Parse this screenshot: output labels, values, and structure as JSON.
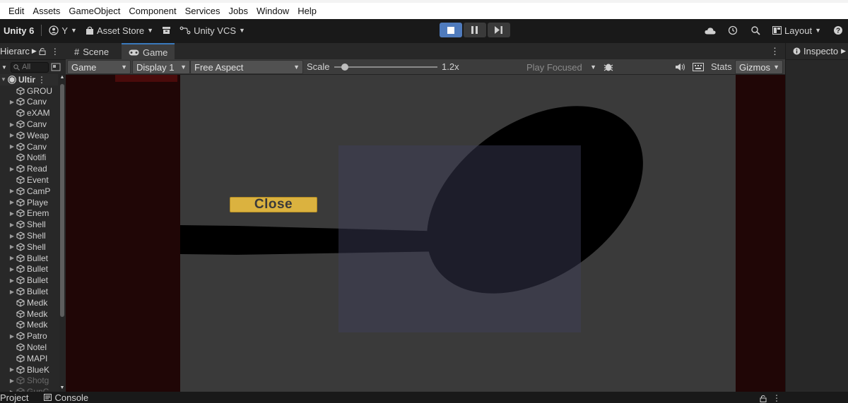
{
  "menu": [
    "Edit",
    "Assets",
    "GameObject",
    "Component",
    "Services",
    "Jobs",
    "Window",
    "Help"
  ],
  "toolbar": {
    "unity_label": "Unity 6",
    "account_label": "Y",
    "asset_store_label": "Asset Store",
    "vcs_label": "Unity VCS",
    "layout_label": "Layout"
  },
  "hierarchy": {
    "tab_label": "Hierarc",
    "search_placeholder": "All",
    "root_label": "Ultir",
    "items": [
      {
        "label": "GROU",
        "arrow": false,
        "dim": false
      },
      {
        "label": "Canv",
        "arrow": true,
        "dim": false
      },
      {
        "label": "eXAM",
        "arrow": false,
        "dim": false
      },
      {
        "label": "Canv",
        "arrow": true,
        "dim": false
      },
      {
        "label": "Weap",
        "arrow": true,
        "dim": false
      },
      {
        "label": "Canv",
        "arrow": true,
        "dim": false
      },
      {
        "label": "Notifi",
        "arrow": false,
        "dim": false
      },
      {
        "label": "Read",
        "arrow": true,
        "dim": false
      },
      {
        "label": "Event",
        "arrow": false,
        "dim": false
      },
      {
        "label": "CamP",
        "arrow": true,
        "dim": false
      },
      {
        "label": "Playe",
        "arrow": true,
        "dim": false
      },
      {
        "label": "Enem",
        "arrow": true,
        "dim": false
      },
      {
        "label": "Shell",
        "arrow": true,
        "dim": false
      },
      {
        "label": "Shell",
        "arrow": true,
        "dim": false
      },
      {
        "label": "Shell",
        "arrow": true,
        "dim": false
      },
      {
        "label": "Bullet",
        "arrow": true,
        "dim": false
      },
      {
        "label": "Bullet",
        "arrow": true,
        "dim": false
      },
      {
        "label": "Bullet",
        "arrow": true,
        "dim": false
      },
      {
        "label": "Bullet",
        "arrow": true,
        "dim": false
      },
      {
        "label": "Medk",
        "arrow": false,
        "dim": false
      },
      {
        "label": "Medk",
        "arrow": false,
        "dim": false
      },
      {
        "label": "Medk",
        "arrow": false,
        "dim": false
      },
      {
        "label": "Patro",
        "arrow": true,
        "dim": false
      },
      {
        "label": "Notel",
        "arrow": false,
        "dim": false
      },
      {
        "label": "MAPI",
        "arrow": false,
        "dim": false
      },
      {
        "label": "BlueK",
        "arrow": true,
        "dim": false
      },
      {
        "label": "Shotg",
        "arrow": true,
        "dim": true
      },
      {
        "label": "GunC",
        "arrow": true,
        "dim": true
      }
    ]
  },
  "game_panel": {
    "tab_scene": "Scene",
    "tab_game": "Game",
    "view_dropdown": "Game",
    "display_dropdown": "Display 1",
    "aspect_dropdown": "Free Aspect",
    "scale_label": "Scale",
    "scale_value": "1.2x",
    "scale_fraction": 0.1,
    "play_focused": "Play Focused",
    "stats_label": "Stats",
    "gizmos_label": "Gizmos",
    "close_button": "Close"
  },
  "inspector": {
    "tab_label": "Inspecto"
  },
  "bottom": {
    "project_tab": "Project",
    "console_tab": "Console"
  },
  "colors": {
    "accent_blue": "#4f7bbd",
    "close_button_yellow": "#dbb23f",
    "letterbox_red": "#200606"
  }
}
